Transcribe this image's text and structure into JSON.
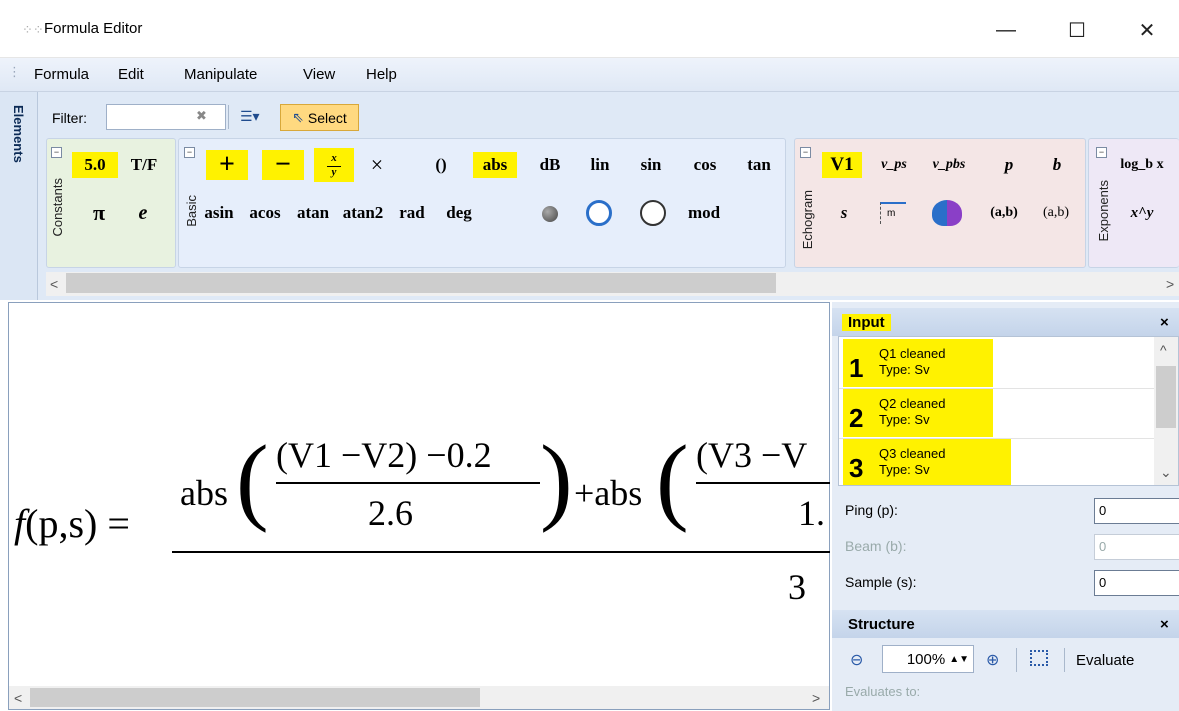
{
  "window": {
    "title": "Formula Editor",
    "minimize": "—",
    "maximize": "☐",
    "close": "✕"
  },
  "menu": [
    "Formula",
    "Edit",
    "Manipulate",
    "View",
    "Help"
  ],
  "elements_tab": "Elements",
  "toolbar": {
    "filter_label": "Filter:",
    "filter_value": "",
    "select_label": "Select"
  },
  "groups": {
    "constants": {
      "label": "Constants",
      "row1": [
        "5.0",
        "T/F"
      ],
      "row2": [
        "π",
        "e"
      ]
    },
    "basic": {
      "label": "Basic",
      "row1": [
        "+",
        "−",
        "x/y",
        "×",
        "()",
        "abs",
        "dB",
        "lin",
        "sin",
        "cos",
        "tan"
      ],
      "row2": [
        "asin",
        "acos",
        "atan",
        "atan2",
        "rad",
        "deg",
        "mod"
      ]
    },
    "echogram": {
      "label": "Echogram",
      "row1": [
        "V1",
        "v_ps",
        "v_pbs",
        "p",
        "b"
      ],
      "row2": [
        "s",
        "(a,b)",
        "(a,b)"
      ]
    },
    "exponents": {
      "label": "Exponents",
      "row1": [
        "log_b x"
      ],
      "row2": [
        "x^y"
      ]
    }
  },
  "formula": {
    "lhs": "f(p,s) =",
    "abs1": "abs",
    "num1": "(V1 −V2) −0.2",
    "den1": "2.6",
    "plus_abs": "+abs",
    "num2": "(V3 −V",
    "den2": "1.",
    "denominator": "3"
  },
  "input_panel": {
    "title": "Input",
    "close": "×",
    "items": [
      {
        "num": "1",
        "name": "Q1 cleaned",
        "type": "Type: Sv"
      },
      {
        "num": "2",
        "name": "Q2 cleaned",
        "type": "Type: Sv"
      },
      {
        "num": "3",
        "name": "Q3 cleaned",
        "type": "Type: Sv"
      }
    ]
  },
  "fields": {
    "ping_label": "Ping (p):",
    "ping_value": "0",
    "beam_label": "Beam (b):",
    "beam_value": "0",
    "sample_label": "Sample (s):",
    "sample_value": "0"
  },
  "structure_panel": {
    "title": "Structure",
    "close": "×",
    "zoom": "100%",
    "evaluate": "Evaluate",
    "evaluates_to": "Evaluates to:"
  },
  "highlight_color": "#fff200"
}
